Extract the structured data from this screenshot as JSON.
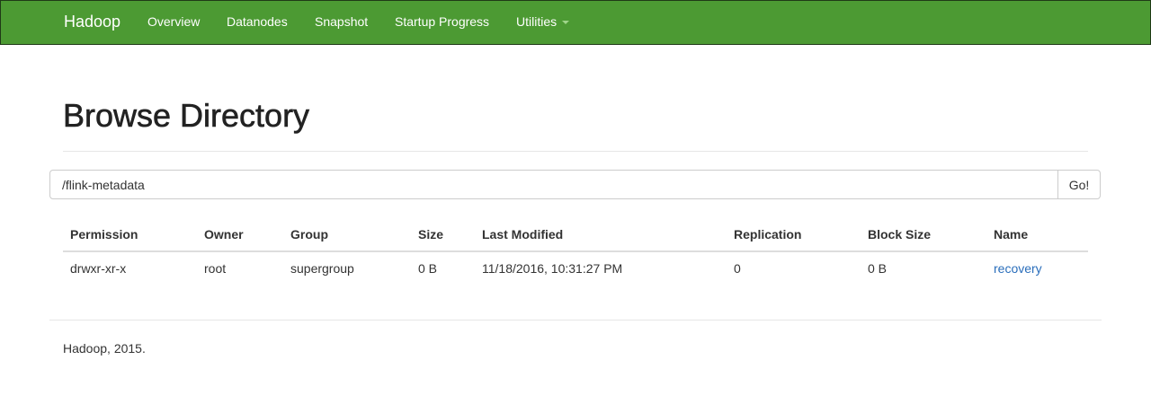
{
  "navbar": {
    "brand": "Hadoop",
    "items": [
      {
        "label": "Overview"
      },
      {
        "label": "Datanodes"
      },
      {
        "label": "Snapshot"
      },
      {
        "label": "Startup Progress"
      },
      {
        "label": "Utilities"
      }
    ],
    "background_color": "#4c9a33"
  },
  "page": {
    "title": "Browse Directory"
  },
  "path_bar": {
    "value": "/flink-metadata",
    "go_label": "Go!"
  },
  "table": {
    "headers": [
      "Permission",
      "Owner",
      "Group",
      "Size",
      "Last Modified",
      "Replication",
      "Block Size",
      "Name"
    ],
    "rows": [
      [
        "drwxr-xr-x",
        "root",
        "supergroup",
        "0 B",
        "11/18/2016, 10:31:27 PM",
        "0",
        "0 B",
        "recovery"
      ]
    ],
    "link_color": "#2a6ebb"
  },
  "footer": {
    "text": "Hadoop, 2015."
  }
}
